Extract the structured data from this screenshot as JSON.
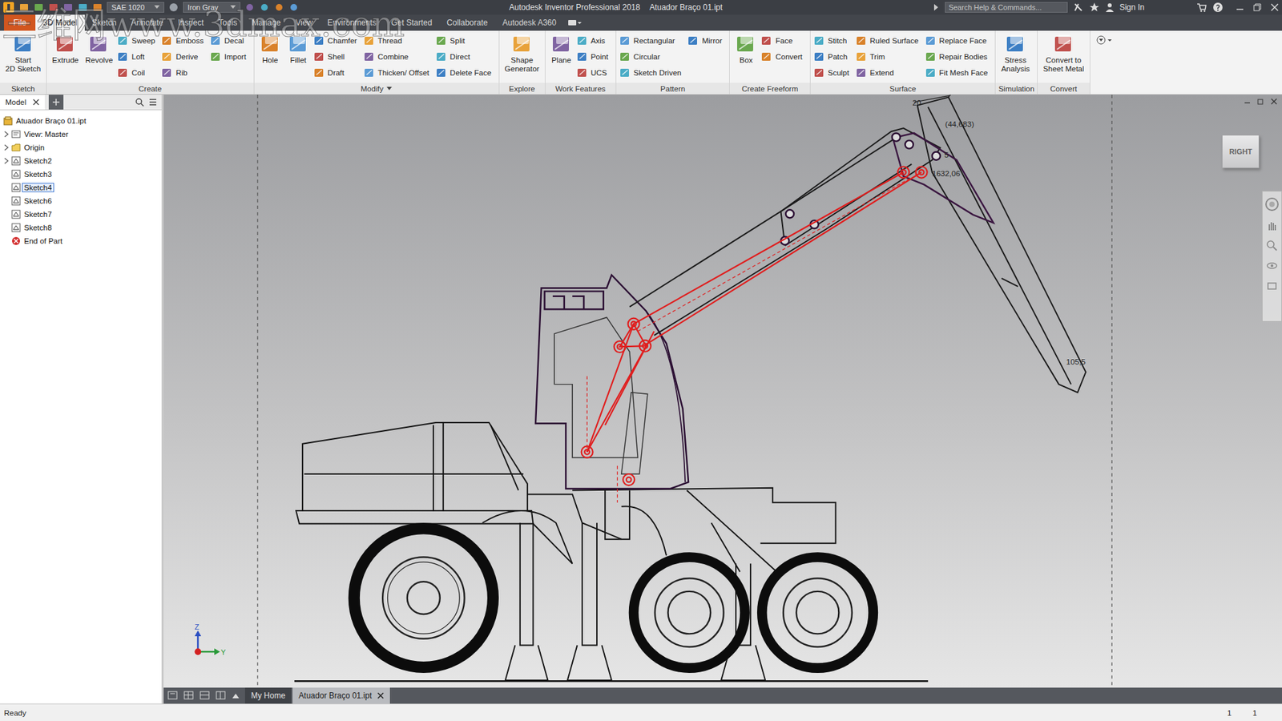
{
  "window": {
    "title": "Autodesk Inventor Professional 2018",
    "file": "Atuador Braço 01.ipt"
  },
  "quick_access": {
    "material": "SAE 1020",
    "appearance": "Iron Gray"
  },
  "search": {
    "placeholder": "Search Help & Commands..."
  },
  "account": "Sign In",
  "watermark": "三维网www.3dmax.com",
  "ribbon_tabs": [
    {
      "label": "File",
      "selected": false,
      "kind": "file"
    },
    {
      "label": "3D Model",
      "selected": true,
      "kind": "tab"
    },
    {
      "label": "Sketch",
      "selected": false,
      "kind": "tab"
    },
    {
      "label": "Annotate",
      "selected": false,
      "kind": "tab"
    },
    {
      "label": "Inspect",
      "selected": false,
      "kind": "tab"
    },
    {
      "label": "Tools",
      "selected": false,
      "kind": "tab"
    },
    {
      "label": "Manage",
      "selected": false,
      "kind": "tab"
    },
    {
      "label": "View",
      "selected": false,
      "kind": "tab"
    },
    {
      "label": "Environments",
      "selected": false,
      "kind": "tab"
    },
    {
      "label": "Get Started",
      "selected": false,
      "kind": "tab"
    },
    {
      "label": "Collaborate",
      "selected": false,
      "kind": "tab"
    },
    {
      "label": "Autodesk A360",
      "selected": false,
      "kind": "tab"
    }
  ],
  "ribbon_panels": [
    {
      "label": "Sketch",
      "dropdown": false,
      "items": [
        {
          "label": "Start\n2D Sketch",
          "kind": "large"
        }
      ]
    },
    {
      "label": "Create",
      "dropdown": false,
      "items": [
        {
          "label": "Extrude",
          "kind": "large"
        },
        {
          "label": "Revolve",
          "kind": "large"
        },
        {
          "label": "Sweep",
          "kind": "small"
        },
        {
          "label": "Loft",
          "kind": "small"
        },
        {
          "label": "Coil",
          "kind": "small"
        },
        {
          "label": "Emboss",
          "kind": "small"
        },
        {
          "label": "Derive",
          "kind": "small"
        },
        {
          "label": "Rib",
          "kind": "small"
        },
        {
          "label": "Decal",
          "kind": "small"
        },
        {
          "label": "Import",
          "kind": "small"
        }
      ]
    },
    {
      "label": "Modify",
      "dropdown": true,
      "items": [
        {
          "label": "Hole",
          "kind": "large"
        },
        {
          "label": "Fillet",
          "kind": "large"
        },
        {
          "label": "Chamfer",
          "kind": "small"
        },
        {
          "label": "Shell",
          "kind": "small"
        },
        {
          "label": "Draft",
          "kind": "small"
        },
        {
          "label": "Thread",
          "kind": "small"
        },
        {
          "label": "Combine",
          "kind": "small"
        },
        {
          "label": "Thicken/ Offset",
          "kind": "small"
        },
        {
          "label": "Split",
          "kind": "small"
        },
        {
          "label": "Direct",
          "kind": "small"
        },
        {
          "label": "Delete Face",
          "kind": "small"
        }
      ]
    },
    {
      "label": "Explore",
      "dropdown": false,
      "items": [
        {
          "label": "Shape\nGenerator",
          "kind": "large"
        }
      ]
    },
    {
      "label": "Work Features",
      "dropdown": false,
      "items": [
        {
          "label": "Plane",
          "kind": "large"
        },
        {
          "label": "Axis",
          "kind": "small"
        },
        {
          "label": "Point",
          "kind": "small"
        },
        {
          "label": "UCS",
          "kind": "small"
        }
      ]
    },
    {
      "label": "Pattern",
      "dropdown": false,
      "items": [
        {
          "label": "Rectangular",
          "kind": "small"
        },
        {
          "label": "Circular",
          "kind": "small"
        },
        {
          "label": "Sketch Driven",
          "kind": "small"
        },
        {
          "label": "Mirror",
          "kind": "small"
        }
      ]
    },
    {
      "label": "Create Freeform",
      "dropdown": false,
      "items": [
        {
          "label": "Box",
          "kind": "large"
        },
        {
          "label": "Face",
          "kind": "small"
        },
        {
          "label": "Convert",
          "kind": "small"
        }
      ]
    },
    {
      "label": "Surface",
      "dropdown": false,
      "items": [
        {
          "label": "Stitch",
          "kind": "small"
        },
        {
          "label": "Patch",
          "kind": "small"
        },
        {
          "label": "Sculpt",
          "kind": "small"
        },
        {
          "label": "Ruled Surface",
          "kind": "small"
        },
        {
          "label": "Trim",
          "kind": "small"
        },
        {
          "label": "Extend",
          "kind": "small"
        },
        {
          "label": "Replace Face",
          "kind": "small"
        },
        {
          "label": "Repair Bodies",
          "kind": "small"
        },
        {
          "label": "Fit Mesh Face",
          "kind": "small"
        }
      ]
    },
    {
      "label": "Simulation",
      "dropdown": false,
      "items": [
        {
          "label": "Stress\nAnalysis",
          "kind": "large"
        }
      ]
    },
    {
      "label": "Convert",
      "dropdown": false,
      "items": [
        {
          "label": "Convert to\nSheet Metal",
          "kind": "large"
        }
      ]
    }
  ],
  "browser": {
    "tab": "Model",
    "items": [
      {
        "label": "Atuador Braço 01.ipt",
        "kind": "part",
        "has_children": false,
        "selected": false
      },
      {
        "label": "View: Master",
        "kind": "view",
        "has_children": true,
        "selected": false
      },
      {
        "label": "Origin",
        "kind": "folder",
        "has_children": true,
        "selected": false
      },
      {
        "label": "Sketch2",
        "kind": "sketch",
        "has_children": true,
        "selected": false
      },
      {
        "label": "Sketch3",
        "kind": "sketch",
        "has_children": false,
        "selected": false
      },
      {
        "label": "Sketch4",
        "kind": "sketch",
        "has_children": false,
        "selected": true
      },
      {
        "label": "Sketch6",
        "kind": "sketch",
        "has_children": false,
        "selected": false
      },
      {
        "label": "Sketch7",
        "kind": "sketch",
        "has_children": false,
        "selected": false
      },
      {
        "label": "Sketch8",
        "kind": "sketch",
        "has_children": false,
        "selected": false
      },
      {
        "label": "End of Part",
        "kind": "end",
        "has_children": false,
        "selected": false
      }
    ]
  },
  "viewcube": "RIGHT",
  "dimensions": [
    "20",
    "(44,683)",
    "1632,06",
    "5",
    "105,5"
  ],
  "axes": [
    "Z",
    "Y"
  ],
  "doc_tabs": [
    {
      "label": "My Home",
      "selected": false,
      "closable": false
    },
    {
      "label": "Atuador Braço 01.ipt",
      "selected": true,
      "closable": true
    }
  ],
  "status": {
    "text": "Ready",
    "counters": [
      "1",
      "1"
    ]
  }
}
